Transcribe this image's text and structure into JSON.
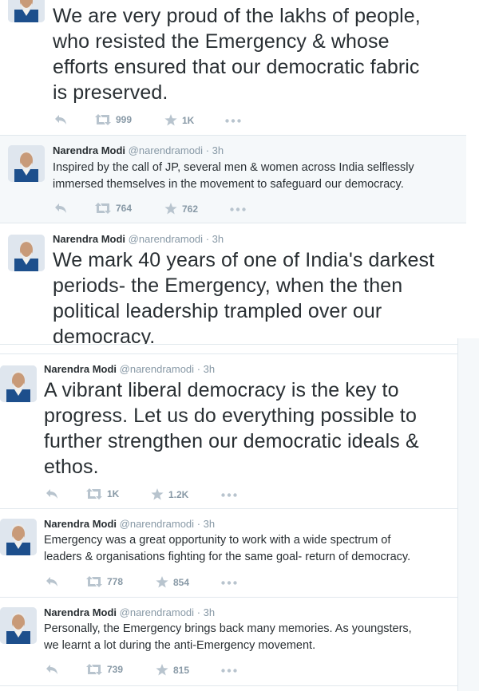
{
  "tweets": [
    {
      "name": "",
      "handle": "",
      "time": "",
      "text_lines": [
        "We are very proud of the lakhs of people,",
        "who resisted the Emergency & whose",
        "efforts ensured that our democratic fabric",
        "is preserved."
      ],
      "retweets": "999",
      "likes": "1K"
    },
    {
      "name": "Narendra Modi",
      "handle": "@narendramodi",
      "time": "3h",
      "text_lines": [
        "Inspired by the call of JP, several men & women across India selflessly",
        "immersed themselves in the movement to safeguard our democracy."
      ],
      "retweets": "764",
      "likes": "762"
    },
    {
      "name": "Narendra Modi",
      "handle": "@narendramodi",
      "time": "3h",
      "text_lines": [
        "We mark 40 years of one of India's darkest",
        "periods- the Emergency, when the then",
        "political leadership trampled over our",
        "democracy."
      ],
      "retweets": "",
      "likes": ""
    },
    {
      "name": "Narendra Modi",
      "handle": "@narendramodi",
      "time": "3h",
      "text_lines": [
        "A vibrant liberal democracy is the key to",
        "progress. Let us do everything possible to",
        "further strengthen our democratic ideals &",
        "ethos."
      ],
      "retweets": "1K",
      "likes": "1.2K"
    },
    {
      "name": "Narendra Modi",
      "handle": "@narendramodi",
      "time": "3h",
      "text_lines": [
        "Emergency was a great opportunity to work with a wide spectrum of",
        "leaders & organisations fighting for the same goal- return of democracy."
      ],
      "retweets": "778",
      "likes": "854"
    },
    {
      "name": "Narendra Modi",
      "handle": "@narendramodi",
      "time": "3h",
      "text_lines": [
        "Personally, the Emergency brings back many memories. As youngsters,",
        "we learnt a lot during the anti-Emergency movement."
      ],
      "retweets": "739",
      "likes": "815"
    }
  ],
  "meta_sep": "·",
  "icons": {
    "reply": "reply-icon",
    "retweet": "retweet-icon",
    "like": "star-icon",
    "more": "more-icon"
  },
  "colors": {
    "text": "#292f33",
    "muted": "#8899a6",
    "highlight_bg": "#f5f8fa",
    "border": "#e1e8ed"
  }
}
